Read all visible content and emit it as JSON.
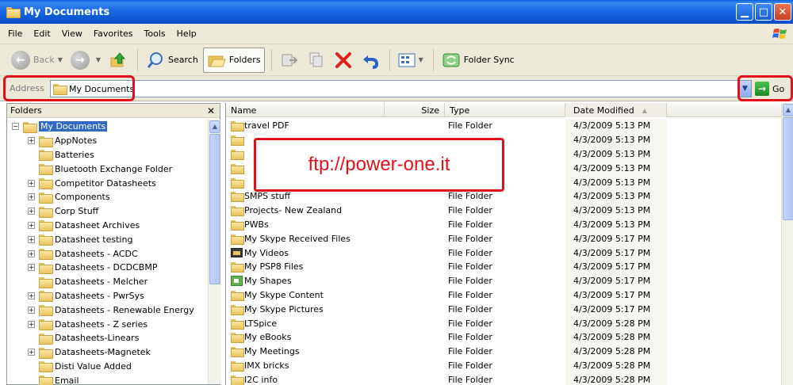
{
  "window": {
    "title": "My Documents"
  },
  "menu": [
    "File",
    "Edit",
    "View",
    "Favorites",
    "Tools",
    "Help"
  ],
  "toolbar": {
    "back": "Back",
    "search": "Search",
    "folders": "Folders",
    "folder_sync": "Folder Sync"
  },
  "address": {
    "label": "Address",
    "value": "My Documents",
    "go": "Go"
  },
  "folders_pane": {
    "title": "Folders",
    "root": "My Documents",
    "items": [
      {
        "label": "AppNotes",
        "expand": true
      },
      {
        "label": "Batteries",
        "expand": false
      },
      {
        "label": "Bluetooth Exchange Folder",
        "expand": false
      },
      {
        "label": "Competitor Datasheets",
        "expand": true
      },
      {
        "label": "Components",
        "expand": true
      },
      {
        "label": "Corp Stuff",
        "expand": true
      },
      {
        "label": "Datasheet Archives",
        "expand": true
      },
      {
        "label": "Datasheet testing",
        "expand": true
      },
      {
        "label": "Datasheets - ACDC",
        "expand": true
      },
      {
        "label": "Datasheets - DCDCBMP",
        "expand": true
      },
      {
        "label": "Datasheets - Melcher",
        "expand": false
      },
      {
        "label": "Datasheets - PwrSys",
        "expand": true
      },
      {
        "label": "Datasheets - Renewable Energy",
        "expand": true
      },
      {
        "label": "Datasheets - Z series",
        "expand": true
      },
      {
        "label": "Datasheets-Linears",
        "expand": false
      },
      {
        "label": "Datasheets-Magnetek",
        "expand": true
      },
      {
        "label": "Disti Value Added",
        "expand": false
      },
      {
        "label": "Email",
        "expand": false
      }
    ]
  },
  "columns": {
    "name": "Name",
    "size": "Size",
    "type": "Type",
    "date": "Date Modified"
  },
  "files": [
    {
      "name": "travel PDF",
      "type": "File Folder",
      "date": "4/3/2009 5:13 PM",
      "icon": "folder"
    },
    {
      "name": "",
      "type": "",
      "date": "4/3/2009 5:13 PM",
      "icon": "folder"
    },
    {
      "name": "",
      "type": "",
      "date": "4/3/2009 5:13 PM",
      "icon": "folder"
    },
    {
      "name": "",
      "type": "",
      "date": "4/3/2009 5:13 PM",
      "icon": "folder"
    },
    {
      "name": "",
      "type": "",
      "date": "4/3/2009 5:13 PM",
      "icon": "folder"
    },
    {
      "name": "SMPS stuff",
      "type": "File Folder",
      "date": "4/3/2009 5:13 PM",
      "icon": "folder"
    },
    {
      "name": "Projects- New Zealand",
      "type": "File Folder",
      "date": "4/3/2009 5:13 PM",
      "icon": "folder"
    },
    {
      "name": "PWBs",
      "type": "File Folder",
      "date": "4/3/2009 5:13 PM",
      "icon": "folder"
    },
    {
      "name": "My Skype Received Files",
      "type": "File Folder",
      "date": "4/3/2009 5:17 PM",
      "icon": "folder"
    },
    {
      "name": "My Videos",
      "type": "File Folder",
      "date": "4/3/2009 5:17 PM",
      "icon": "video"
    },
    {
      "name": "My PSP8 Files",
      "type": "File Folder",
      "date": "4/3/2009 5:17 PM",
      "icon": "folder"
    },
    {
      "name": "My Shapes",
      "type": "File Folder",
      "date": "4/3/2009 5:17 PM",
      "icon": "shapes"
    },
    {
      "name": "My Skype Content",
      "type": "File Folder",
      "date": "4/3/2009 5:17 PM",
      "icon": "folder"
    },
    {
      "name": "My Skype Pictures",
      "type": "File Folder",
      "date": "4/3/2009 5:17 PM",
      "icon": "folder"
    },
    {
      "name": "LTSpice",
      "type": "File Folder",
      "date": "4/3/2009 5:28 PM",
      "icon": "folder"
    },
    {
      "name": "My eBooks",
      "type": "File Folder",
      "date": "4/3/2009 5:28 PM",
      "icon": "folder"
    },
    {
      "name": "My Meetings",
      "type": "File Folder",
      "date": "4/3/2009 5:28 PM",
      "icon": "folder"
    },
    {
      "name": "IMX bricks",
      "type": "File Folder",
      "date": "4/3/2009 5:28 PM",
      "icon": "folder"
    },
    {
      "name": "I2C info",
      "type": "File Folder",
      "date": "4/3/2009 5:28 PM",
      "icon": "folder"
    }
  ],
  "overlay": {
    "text": "ftp://power-one.it"
  },
  "colors": {
    "titlebar": "#0b4fc4",
    "highlight": "#e3101b",
    "selection": "#316ac5",
    "chrome": "#ece9d8"
  }
}
